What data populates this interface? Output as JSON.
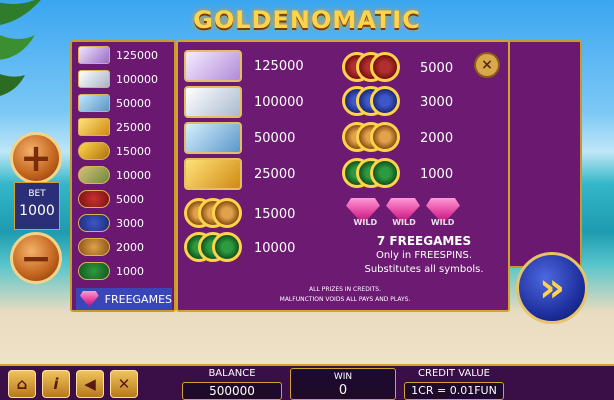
{
  "title": "GOLDENOMATIC",
  "mini_paytable": {
    "items": [
      {
        "icon": "yacht-symbol-icon",
        "value": "125000"
      },
      {
        "icon": "mansion-symbol-icon",
        "value": "100000"
      },
      {
        "icon": "jet-symbol-icon",
        "value": "50000"
      },
      {
        "icon": "sportscar-symbol-icon",
        "value": "25000"
      },
      {
        "icon": "gold-bars-symbol-icon",
        "value": "15000"
      },
      {
        "icon": "banknotes-symbol-icon",
        "value": "10000"
      },
      {
        "icon": "red-seven-coins-icon",
        "value": "5000"
      },
      {
        "icon": "blue-bar-coins-icon",
        "value": "3000"
      },
      {
        "icon": "bell-coins-icon",
        "value": "2000"
      },
      {
        "icon": "cherry-coins-icon",
        "value": "1000"
      }
    ],
    "freegames_label": "FREEGAMES"
  },
  "paytable": {
    "left": [
      {
        "icon": "yacht-symbol-icon",
        "value": "125000"
      },
      {
        "icon": "mansion-symbol-icon",
        "value": "100000"
      },
      {
        "icon": "jet-symbol-icon",
        "value": "50000"
      },
      {
        "icon": "sportscar-symbol-icon",
        "value": "25000"
      },
      {
        "icon": "gold-bars-symbol-icon",
        "value": "15000"
      },
      {
        "icon": "banknotes-symbol-icon",
        "value": "10000"
      }
    ],
    "right": [
      {
        "icon": "red-seven-coins-icon",
        "value": "5000"
      },
      {
        "icon": "blue-bar-coins-icon",
        "value": "3000"
      },
      {
        "icon": "bell-coins-icon",
        "value": "2000"
      },
      {
        "icon": "cherry-coins-icon",
        "value": "1000"
      }
    ],
    "wild_text": "WILD",
    "freegames_title": "7 FREEGAMES",
    "freegames_line1": "Only in FREESPINS.",
    "freegames_line2": "Substitutes all symbols.",
    "note_line1": "ALL PRIZES IN CREDITS.",
    "note_line2": "MALFUNCTION VOIDS ALL PAYS AND PLAYS.",
    "close_symbol": "×"
  },
  "bet": {
    "label": "BET",
    "value": "1000",
    "plus_symbol": "+",
    "minus_symbol": "−"
  },
  "spin_symbol": "»",
  "toolbar": {
    "home_symbol": "⌂",
    "info_symbol": "i",
    "sound_symbol": "◀",
    "settings_symbol": "✕"
  },
  "balance": {
    "label": "BALANCE",
    "value": "500000"
  },
  "win": {
    "label": "WIN",
    "value": "0"
  },
  "credit": {
    "label": "CREDIT VALUE",
    "value": "1CR = 0.01FUN"
  },
  "colors": {
    "panel_purple": "#6c1a72",
    "gold_border": "#d2a32e",
    "freegames_highlight": "#3a46b8"
  }
}
